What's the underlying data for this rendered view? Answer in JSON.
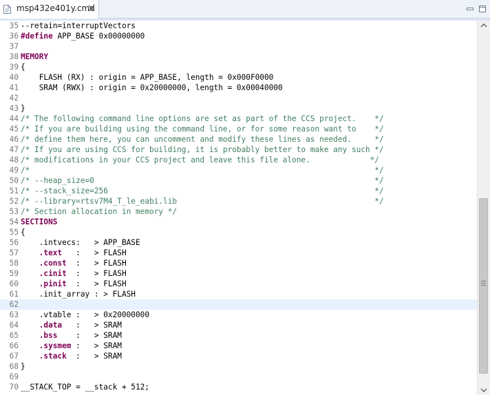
{
  "tab": {
    "title": "msp432e401y.cmd"
  },
  "editor": {
    "current_line": 62,
    "lines": [
      {
        "num": 35,
        "segments": [
          {
            "t": "--retain=interruptVectors",
            "s": ""
          }
        ]
      },
      {
        "num": 36,
        "segments": [
          {
            "t": "#define",
            "s": "kw"
          },
          {
            "t": " APP_BASE 0x00000000",
            "s": ""
          }
        ]
      },
      {
        "num": 37,
        "segments": []
      },
      {
        "num": 38,
        "segments": [
          {
            "t": "MEMORY",
            "s": "kw"
          }
        ]
      },
      {
        "num": 39,
        "segments": [
          {
            "t": "{",
            "s": ""
          }
        ]
      },
      {
        "num": 40,
        "segments": [
          {
            "t": "    FLASH (RX) : origin = APP_BASE, length = 0x000F0000",
            "s": ""
          }
        ]
      },
      {
        "num": 41,
        "segments": [
          {
            "t": "    SRAM (RWX) : origin = 0x20000000, length = 0x00040000",
            "s": ""
          }
        ]
      },
      {
        "num": 42,
        "segments": []
      },
      {
        "num": 43,
        "segments": [
          {
            "t": "}",
            "s": ""
          }
        ]
      },
      {
        "num": 44,
        "segments": [
          {
            "t": "/* The following command line options are set as part of the CCS project.    */",
            "s": "cm"
          }
        ]
      },
      {
        "num": 45,
        "segments": [
          {
            "t": "/* If you are building using the command line, or for some reason want to    */",
            "s": "cm"
          }
        ]
      },
      {
        "num": 46,
        "segments": [
          {
            "t": "/* define them here, you can uncomment and modify these lines as needed.     */",
            "s": "cm"
          }
        ]
      },
      {
        "num": 47,
        "segments": [
          {
            "t": "/* If you are using CCS for building, it is probably better to make any such */",
            "s": "cm"
          }
        ]
      },
      {
        "num": 48,
        "segments": [
          {
            "t": "/* modifications in your CCS project and leave this file alone.             */",
            "s": "cm"
          }
        ]
      },
      {
        "num": 49,
        "segments": [
          {
            "t": "/*                                                                           */",
            "s": "cm"
          }
        ]
      },
      {
        "num": 50,
        "segments": [
          {
            "t": "/* --heap_size=0                                                             */",
            "s": "cm"
          }
        ]
      },
      {
        "num": 51,
        "segments": [
          {
            "t": "/* --stack_size=256                                                          */",
            "s": "cm"
          }
        ]
      },
      {
        "num": 52,
        "segments": [
          {
            "t": "/* --library=rtsv7M4_T_le_eabi.lib                                           */",
            "s": "cm"
          }
        ]
      },
      {
        "num": 53,
        "segments": [
          {
            "t": "/* Section allocation in memory */",
            "s": "cm"
          }
        ]
      },
      {
        "num": 54,
        "segments": [
          {
            "t": "SECTIONS",
            "s": "kw"
          }
        ]
      },
      {
        "num": 55,
        "segments": [
          {
            "t": "{",
            "s": ""
          }
        ]
      },
      {
        "num": 56,
        "segments": [
          {
            "t": "    .intvecs:   > APP_BASE",
            "s": ""
          }
        ]
      },
      {
        "num": 57,
        "segments": [
          {
            "t": "    ",
            "s": ""
          },
          {
            "t": ".text",
            "s": "kw"
          },
          {
            "t": "   :   > FLASH",
            "s": ""
          }
        ]
      },
      {
        "num": 58,
        "segments": [
          {
            "t": "    ",
            "s": ""
          },
          {
            "t": ".const",
            "s": "kw"
          },
          {
            "t": "  :   > FLASH",
            "s": ""
          }
        ]
      },
      {
        "num": 59,
        "segments": [
          {
            "t": "    ",
            "s": ""
          },
          {
            "t": ".cinit",
            "s": "kw"
          },
          {
            "t": "  :   > FLASH",
            "s": ""
          }
        ]
      },
      {
        "num": 60,
        "segments": [
          {
            "t": "    ",
            "s": ""
          },
          {
            "t": ".pinit",
            "s": "kw"
          },
          {
            "t": "  :   > FLASH",
            "s": ""
          }
        ]
      },
      {
        "num": 61,
        "segments": [
          {
            "t": "    .init_array : > FLASH",
            "s": ""
          }
        ]
      },
      {
        "num": 62,
        "segments": []
      },
      {
        "num": 63,
        "segments": [
          {
            "t": "    .vtable :   > 0x20000000",
            "s": ""
          }
        ]
      },
      {
        "num": 64,
        "segments": [
          {
            "t": "    ",
            "s": ""
          },
          {
            "t": ".data",
            "s": "kw"
          },
          {
            "t": "   :   > SRAM",
            "s": ""
          }
        ]
      },
      {
        "num": 65,
        "segments": [
          {
            "t": "    ",
            "s": ""
          },
          {
            "t": ".bss",
            "s": "kw"
          },
          {
            "t": "    :   > SRAM",
            "s": ""
          }
        ]
      },
      {
        "num": 66,
        "segments": [
          {
            "t": "    ",
            "s": ""
          },
          {
            "t": ".sysmem",
            "s": "kw"
          },
          {
            "t": " :   > SRAM",
            "s": ""
          }
        ]
      },
      {
        "num": 67,
        "segments": [
          {
            "t": "    ",
            "s": ""
          },
          {
            "t": ".stack",
            "s": "kw"
          },
          {
            "t": "  :   > SRAM",
            "s": ""
          }
        ]
      },
      {
        "num": 68,
        "segments": [
          {
            "t": "}",
            "s": ""
          }
        ]
      },
      {
        "num": 69,
        "segments": []
      },
      {
        "num": 70,
        "segments": [
          {
            "t": "__STACK_TOP = __stack + 512;",
            "s": ""
          }
        ]
      }
    ]
  },
  "icons": {
    "file": "cmd-file-icon",
    "close": "close-icon",
    "minimize": "minimize-icon",
    "maximize": "maximize-icon",
    "scroll_up": "chevron-up-icon",
    "scroll_down": "chevron-down-icon"
  }
}
